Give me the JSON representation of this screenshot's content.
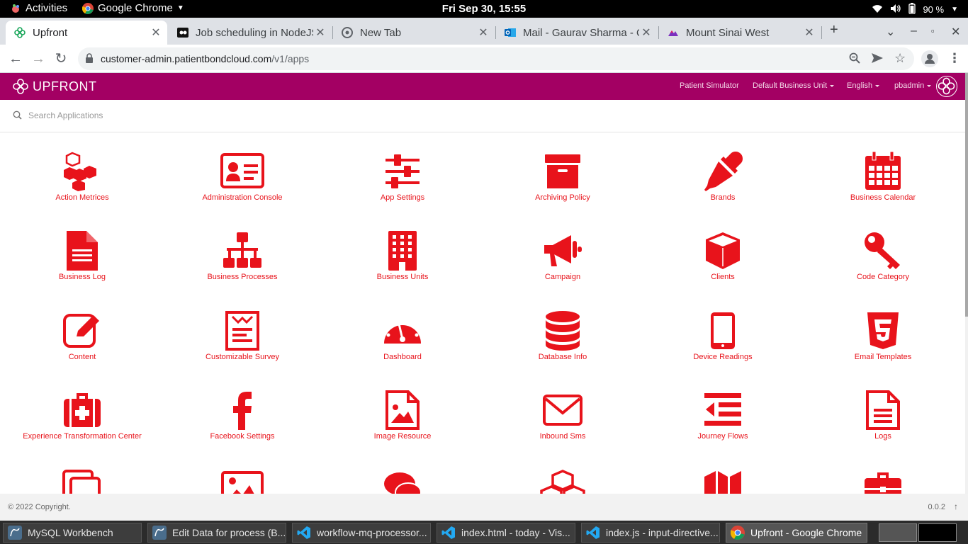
{
  "system": {
    "activities": "Activities",
    "app_name": "Google Chrome",
    "clock": "Fri Sep 30, 15:55",
    "battery": "90 %"
  },
  "browser": {
    "tabs": [
      {
        "label": "Upfront",
        "icon": "upfront-logo-icon",
        "active": true
      },
      {
        "label": "Job scheduling in NodeJS",
        "icon": "video-icon",
        "active": false
      },
      {
        "label": "New Tab",
        "icon": "chrome-icon",
        "active": false
      },
      {
        "label": "Mail - Gaurav Sharma - O",
        "icon": "outlook-icon",
        "active": false
      },
      {
        "label": "Mount Sinai West",
        "icon": "mountain-icon",
        "active": false
      }
    ],
    "url_host": "customer-admin.patientbondcloud.com",
    "url_path": "/v1/apps"
  },
  "header": {
    "brand": "UPFRONT",
    "menu": [
      "Patient Simulator",
      "Default Business Unit",
      "English",
      "pbadmin"
    ],
    "colors": {
      "header_bg": "#a30063",
      "icon_red": "#e8131b"
    }
  },
  "search": {
    "placeholder": "Search Applications",
    "value": ""
  },
  "apps": [
    {
      "label": "Action Metrices",
      "icon": "cubes-icon"
    },
    {
      "label": "Administration Console",
      "icon": "id-card-icon"
    },
    {
      "label": "App Settings",
      "icon": "sliders-icon"
    },
    {
      "label": "Archiving Policy",
      "icon": "archive-icon"
    },
    {
      "label": "Brands",
      "icon": "eyedropper-icon"
    },
    {
      "label": "Business Calendar",
      "icon": "calendar-icon"
    },
    {
      "label": "Business Log",
      "icon": "file-text-icon"
    },
    {
      "label": "Business Processes",
      "icon": "sitemap-icon"
    },
    {
      "label": "Business Units",
      "icon": "building-icon"
    },
    {
      "label": "Campaign",
      "icon": "bullhorn-icon"
    },
    {
      "label": "Clients",
      "icon": "cube-icon"
    },
    {
      "label": "Code Category",
      "icon": "key-icon"
    },
    {
      "label": "Content",
      "icon": "edit-icon"
    },
    {
      "label": "Customizable Survey",
      "icon": "survey-icon"
    },
    {
      "label": "Dashboard",
      "icon": "dashboard-icon"
    },
    {
      "label": "Database Info",
      "icon": "database-icon"
    },
    {
      "label": "Device Readings",
      "icon": "tablet-icon"
    },
    {
      "label": "Email Templates",
      "icon": "html5-icon"
    },
    {
      "label": "Experience Transformation Center",
      "icon": "medkit-icon"
    },
    {
      "label": "Facebook Settings",
      "icon": "facebook-icon"
    },
    {
      "label": "Image Resource",
      "icon": "file-image-icon"
    },
    {
      "label": "Inbound Sms",
      "icon": "envelope-icon"
    },
    {
      "label": "Journey Flows",
      "icon": "outdent-icon"
    },
    {
      "label": "Logs",
      "icon": "file-lines-icon"
    },
    {
      "label": "",
      "icon": "copy-icon"
    },
    {
      "label": "",
      "icon": "image-icon"
    },
    {
      "label": "",
      "icon": "comments-icon"
    },
    {
      "label": "",
      "icon": "cubes2-icon"
    },
    {
      "label": "",
      "icon": "map-icon"
    },
    {
      "label": "",
      "icon": "briefcase-icon"
    }
  ],
  "footer": {
    "copyright": "© 2022 Copyright.",
    "version": "0.0.2",
    "up_arrow": "↑"
  },
  "taskbar": [
    {
      "label": "MySQL Workbench",
      "icon": "mysql-icon"
    },
    {
      "label": "Edit Data for process (B...",
      "icon": "mysql-icon"
    },
    {
      "label": "workflow-mq-processor...",
      "icon": "vscode-icon"
    },
    {
      "label": "index.html - today - Vis...",
      "icon": "vscode-icon"
    },
    {
      "label": "index.js - input-directive...",
      "icon": "vscode-icon"
    },
    {
      "label": "Upfront - Google Chrome",
      "icon": "chrome-icon",
      "active": true
    }
  ]
}
